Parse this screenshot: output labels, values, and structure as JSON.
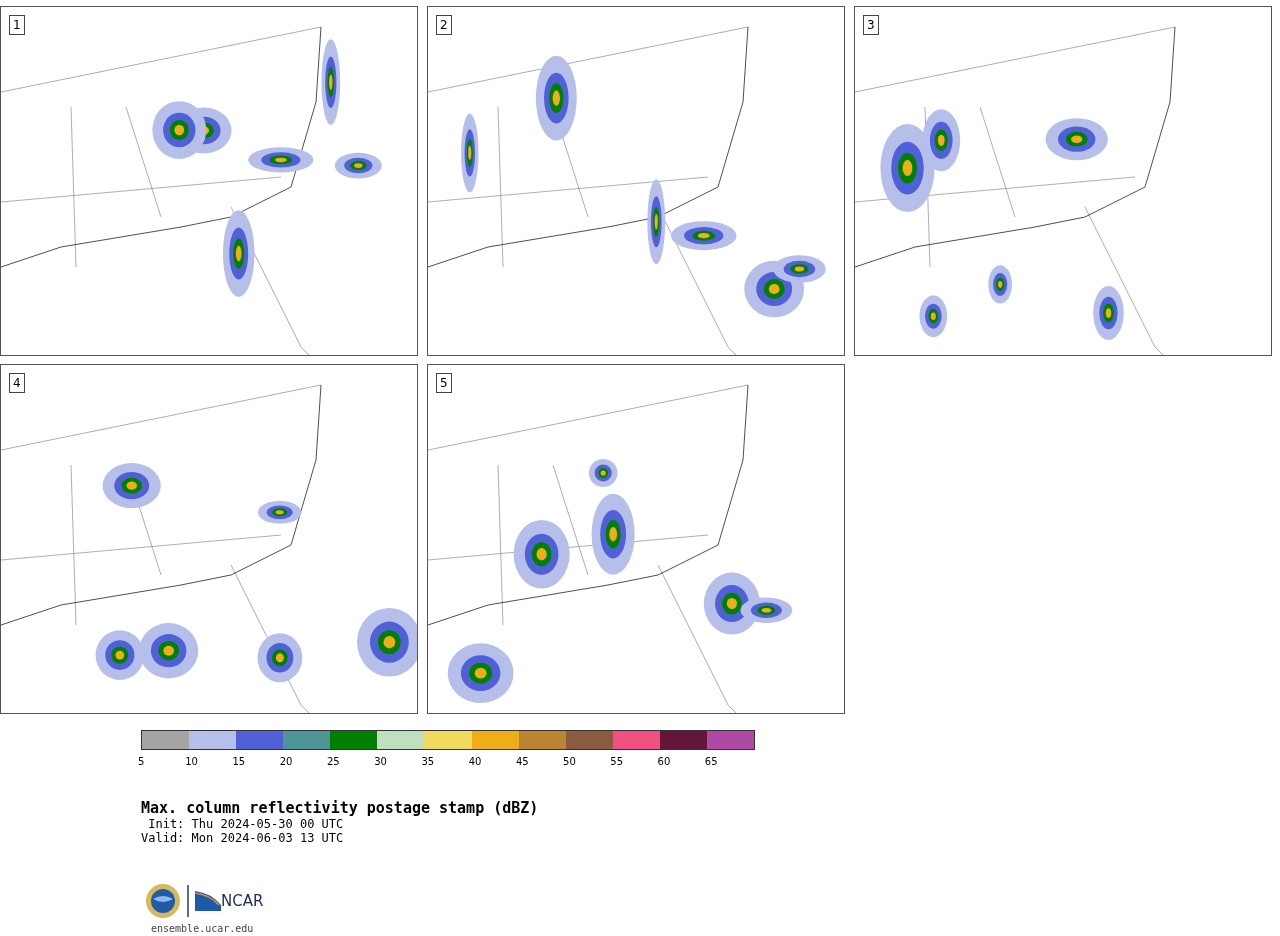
{
  "panels": [
    {
      "label": "1"
    },
    {
      "label": "2"
    },
    {
      "label": "3"
    },
    {
      "label": "4"
    },
    {
      "label": "5"
    }
  ],
  "colorbar": {
    "segments": [
      {
        "color": "#a5a5a5",
        "label": "5"
      },
      {
        "color": "#b5bfea",
        "label": "10"
      },
      {
        "color": "#5060d6",
        "label": "15"
      },
      {
        "color": "#4f9598",
        "label": "20"
      },
      {
        "color": "#008000",
        "label": "25"
      },
      {
        "color": "#bfdfbf",
        "label": "30"
      },
      {
        "color": "#f0db5d",
        "label": "35"
      },
      {
        "color": "#f0ad1a",
        "label": "40"
      },
      {
        "color": "#ba8431",
        "label": "45"
      },
      {
        "color": "#8a5b3f",
        "label": "50"
      },
      {
        "color": "#f25080",
        "label": "55"
      },
      {
        "color": "#621738",
        "label": "60"
      },
      {
        "color": "#ae4aa5",
        "label": "65"
      }
    ]
  },
  "title": "Max. column reflectivity postage stamp (dBZ)",
  "init": " Init: Thu 2024-05-30 00 UTC",
  "valid": "Valid: Mon 2024-06-03 13 UTC",
  "footer": {
    "brand": "NCAR",
    "url": "ensemble.ucar.edu"
  }
}
